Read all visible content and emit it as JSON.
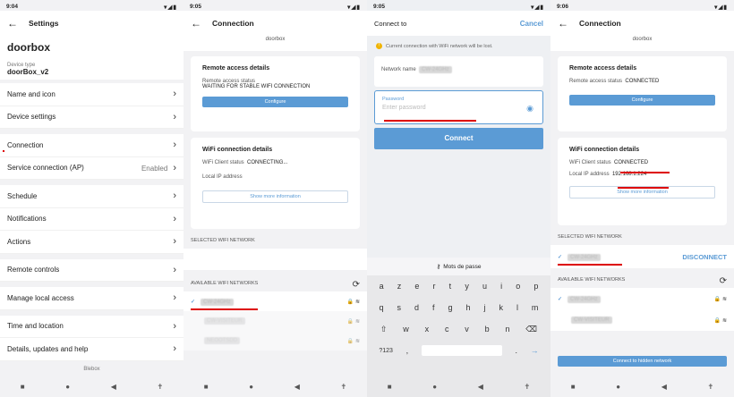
{
  "p1": {
    "time": "9:04",
    "title": "Settings",
    "device_name": "doorbox",
    "device_type_label": "Device type",
    "device_type": "doorBox_v2",
    "items": [
      {
        "label": "Name and icon"
      },
      {
        "label": "Device settings"
      },
      {
        "label": "Connection"
      },
      {
        "label": "Service connection (AP)",
        "value": "Enabled"
      },
      {
        "label": "Schedule"
      },
      {
        "label": "Notifications"
      },
      {
        "label": "Actions"
      },
      {
        "label": "Remote controls"
      },
      {
        "label": "Manage local access"
      },
      {
        "label": "Time and location"
      },
      {
        "label": "Details, updates and help"
      }
    ],
    "footer": "Blebox"
  },
  "p2": {
    "time": "9:05",
    "title": "Connection",
    "device": "doorbox",
    "remote_title": "Remote access details",
    "remote_status_label": "Remote access status",
    "remote_status": "WAITING FOR STABLE WIFI CONNECTION",
    "configure": "Configure",
    "wifi_title": "WiFi connection details",
    "wifi_status_label": "WiFi Client status",
    "wifi_status": "CONNECTING...",
    "ip_label": "Local IP address",
    "show_more": "Show more information",
    "selected_label": "SELECTED WIFI NETWORK",
    "available_label": "AVAILABLE WIFI NETWORKS",
    "networks": [
      "CW-24GHz",
      "CW-VISITEUR",
      "NEOOTSDD"
    ]
  },
  "p3": {
    "time": "9:05",
    "title": "Connect to",
    "cancel": "Cancel",
    "warning": "Current connection with WiFi network will be lost.",
    "network_label": "Network name",
    "network_name": "CW-24GHz",
    "password_label": "Password",
    "password_placeholder": "Enter password",
    "connect": "Connect",
    "kbd_title": "Mots de passe",
    "row1": [
      "a",
      "z",
      "e",
      "r",
      "t",
      "y",
      "u",
      "i",
      "o",
      "p"
    ],
    "row2": [
      "q",
      "s",
      "d",
      "f",
      "g",
      "h",
      "j",
      "k",
      "l",
      "m"
    ],
    "row3": [
      "w",
      "x",
      "c",
      "v",
      "b",
      "n"
    ],
    "sym": "?123"
  },
  "p4": {
    "time": "9:06",
    "title": "Connection",
    "device": "doorbox",
    "remote_title": "Remote access details",
    "remote_status_label": "Remote access status",
    "remote_status": "CONNECTED",
    "configure": "Configure",
    "wifi_title": "WiFi connection details",
    "wifi_status_label": "WiFi Client status",
    "wifi_status": "CONNECTED",
    "ip_label": "Local IP address",
    "ip": "192.168.1.224",
    "show_more": "Show more information",
    "selected_label": "SELECTED WIFI NETWORK",
    "selected_network": "CW-24GHz",
    "disconnect": "DISCONNECT",
    "available_label": "AVAILABLE WIFI NETWORKS",
    "networks": [
      "CW-24GHz",
      "CW-VISITEUR"
    ],
    "hidden": "Connect to hidden network"
  }
}
